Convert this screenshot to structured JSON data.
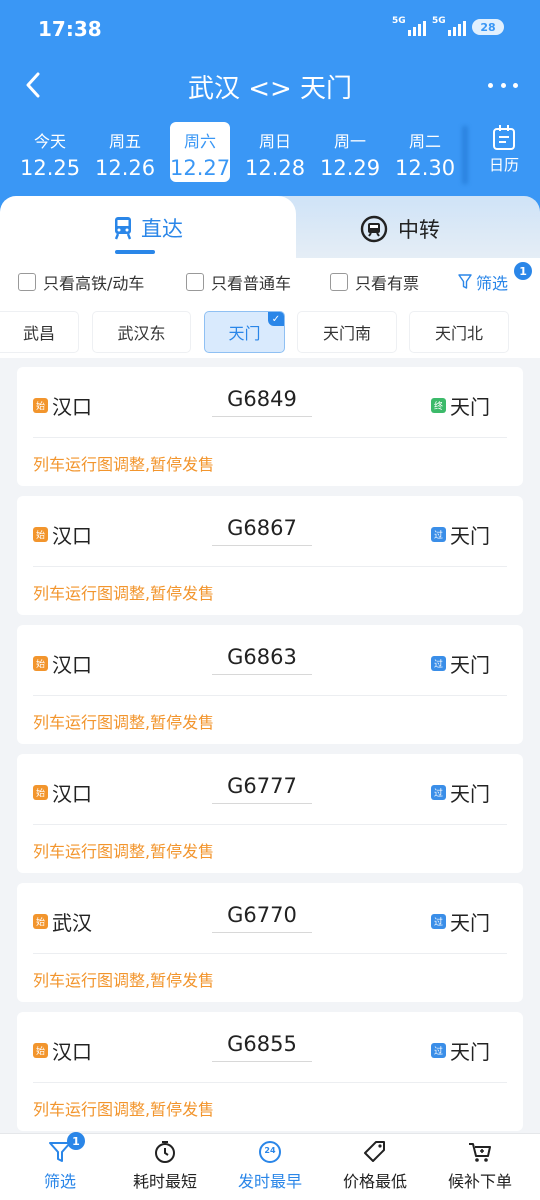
{
  "status_bar": {
    "time": "17:38",
    "network1": "5G",
    "network2": "5G",
    "battery": "28"
  },
  "nav": {
    "title": "武汉 <> 天门"
  },
  "dates": [
    {
      "weekday": "今天",
      "date": "12.25",
      "active": false
    },
    {
      "weekday": "周五",
      "date": "12.26",
      "active": false
    },
    {
      "weekday": "周六",
      "date": "12.27",
      "active": true
    },
    {
      "weekday": "周日",
      "date": "12.28",
      "active": false
    },
    {
      "weekday": "周一",
      "date": "12.29",
      "active": false
    },
    {
      "weekday": "周二",
      "date": "12.30",
      "active": false
    }
  ],
  "calendar_label": "日历",
  "tabs": {
    "direct": "直达",
    "transfer": "中转"
  },
  "checks": {
    "high_speed": "只看高铁/动车",
    "normal": "只看普通车",
    "available": "只看有票"
  },
  "filter": {
    "label": "筛选",
    "count": "1"
  },
  "stations": [
    {
      "name": "武昌",
      "active": false
    },
    {
      "name": "武汉东",
      "active": false
    },
    {
      "name": "天门",
      "active": true
    },
    {
      "name": "天门南",
      "active": false
    },
    {
      "name": "天门北",
      "active": false
    }
  ],
  "tag_labels": {
    "start": "始",
    "end": "终",
    "pass": "过"
  },
  "trains": [
    {
      "from": "汉口",
      "train_no": "G6849",
      "to": "天门",
      "to_type": "end",
      "notice": "列车运行图调整,暂停发售"
    },
    {
      "from": "汉口",
      "train_no": "G6867",
      "to": "天门",
      "to_type": "pass",
      "notice": "列车运行图调整,暂停发售"
    },
    {
      "from": "汉口",
      "train_no": "G6863",
      "to": "天门",
      "to_type": "pass",
      "notice": "列车运行图调整,暂停发售"
    },
    {
      "from": "汉口",
      "train_no": "G6777",
      "to": "天门",
      "to_type": "pass",
      "notice": "列车运行图调整,暂停发售"
    },
    {
      "from": "武汉",
      "train_no": "G6770",
      "to": "天门",
      "to_type": "pass",
      "notice": "列车运行图调整,暂停发售"
    },
    {
      "from": "汉口",
      "train_no": "G6855",
      "to": "天门",
      "to_type": "pass",
      "notice": "列车运行图调整,暂停发售"
    }
  ],
  "bottom_bar": {
    "filter": "筛选",
    "filter_badge": "1",
    "shortest": "耗时最短",
    "earliest": "发时最早",
    "earliest_icon_text": "24",
    "cheapest": "价格最低",
    "waitlist": "候补下单"
  },
  "colors": {
    "primary": "#3a97f5",
    "accent": "#2a86e8",
    "warning": "#f2952d",
    "end_tag": "#3cba6a"
  }
}
